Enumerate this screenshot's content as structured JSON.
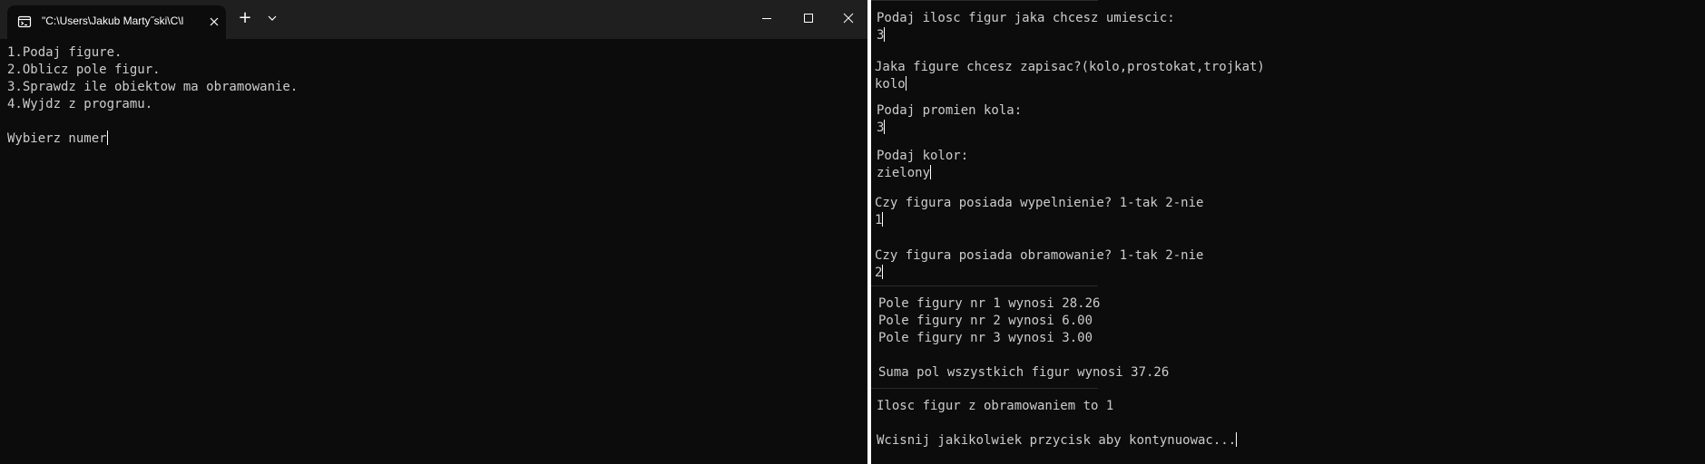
{
  "left_window": {
    "tab_title": "\"C:\\Users\\Jakub Marty˝ski\\C\\l",
    "new_tab_glyph": "+",
    "menu_lines": [
      "1.Podaj figure.",
      "2.Oblicz pole figur.",
      "3.Sprawdz ile obiektow ma obramowanie.",
      "4.Wyjdz z programu."
    ],
    "prompt": "Wybierz numer"
  },
  "right_panel": {
    "q_count": "Podaj ilosc figur jaka chcesz umiescic:",
    "a_count": "3",
    "q_type": "Jaka figure chcesz zapisac?(kolo,prostokat,trojkat)",
    "a_type": "kolo",
    "q_radius": "Podaj promien kola:",
    "a_radius": "3",
    "q_color": "Podaj kolor:",
    "a_color": "zielony",
    "q_fill": "Czy figura posiada wypelnienie? 1-tak 2-nie",
    "a_fill": "1",
    "q_border": "Czy figura posiada obramowanie? 1-tak 2-nie",
    "a_border": "2",
    "area_1": "Pole figury nr 1 wynosi 28.26",
    "area_2": "Pole figury nr 2 wynosi 6.00",
    "area_3": "Pole figury nr 3 wynosi 3.00",
    "sum": "Suma pol wszystkich figur wynosi 37.26",
    "border_count": "Ilosc figur z obramowaniem to 1",
    "press_key": "Wcisnij jakikolwiek przycisk aby kontynuowac..."
  },
  "colors": {
    "terminal_bg": "#0c0c0c",
    "titlebar_bg": "#1f1f1f",
    "text": "#cccccc",
    "separator": "#ffffff"
  }
}
